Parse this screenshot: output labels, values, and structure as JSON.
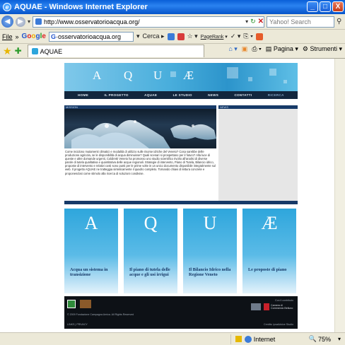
{
  "window": {
    "title": "AQUAE - Windows Internet Explorer",
    "buttons": {
      "minimize": "_",
      "maximize": "□",
      "close": "X"
    }
  },
  "addressbar": {
    "url": "http://www.osservatorioacqua.org/",
    "search_placeholder": "Yahoo! Search"
  },
  "google_toolbar": {
    "menu_file": "File",
    "chevron": "»",
    "logo": [
      "G",
      "o",
      "o",
      "g",
      "l",
      "e"
    ],
    "search_value": "osservatorioacqua.org",
    "search_label": "Cerca",
    "pagerank_label": "PageRank"
  },
  "tabs": {
    "active_tab": "AQUAE",
    "page_label": "Pagina",
    "tools_label": "Strumenti"
  },
  "site": {
    "banner_letters": [
      "A",
      "Q",
      "U",
      "Æ"
    ],
    "menu": [
      "HOME",
      "IL PROGETTO",
      "AQUAE",
      "LE STUDIO",
      "NEWS",
      "CONTATTI",
      "RICERCA"
    ],
    "left_heading": "MISSION",
    "right_heading": "NEWS",
    "mission_text": "Come incidono mutamenti climatici e modalità di utilizzo sulle risorse idriche del Veneto? Cosa sarebbe delle produzione agricola, se le disponibilità di acqua diminuisse? Quali scenari si prospettano per il futuro? Alla luce di queste e altre domande urgenti, Coldiretti Veneto ha promosso uno studio scientifico rivolto all'analisi di diverse parole di tutela qualitativa e quantitativa delle acque regionali. Strategie di intervento, Piano di Tutela, Bilancio idrico, proposte di intervento e relativi costi sono punti per le prime volte in un unico documento disponibile integralmente sul web. Il progetto AQUAE ne tratteggia sinteticamente il quadro completo. Tornando chiavi di lettura concrete e proponendosi come stimolo alla ricerca di soluzioni condivise.",
    "cards": [
      {
        "letter": "A",
        "title": "Acqua un sistema in transizione"
      },
      {
        "letter": "Q",
        "title": "Il piano di tutela delle acque e gli usi irrigui"
      },
      {
        "letter": "U",
        "title": "Il Bilancio Idrico nella Regione Veneto"
      },
      {
        "letter": "Æ",
        "title": "Le proposte di piano"
      }
    ],
    "footer": {
      "copyright": "© 2009 Fondazione Campagna Amica. All Rights Reserved",
      "links": "LINKS | PRIVACY",
      "right_top": "Con il contributo",
      "chamber": "Camera di Commercio Belluno",
      "credits": "Credits: ipsaAdvice Studio"
    }
  },
  "statusbar": {
    "zone": "Internet",
    "zoom": "75%"
  },
  "colors": {
    "titlebar": "#0a5fd8",
    "site_navy": "#12263d",
    "aqua": "#2ea6dc",
    "card_title": "#153766"
  }
}
